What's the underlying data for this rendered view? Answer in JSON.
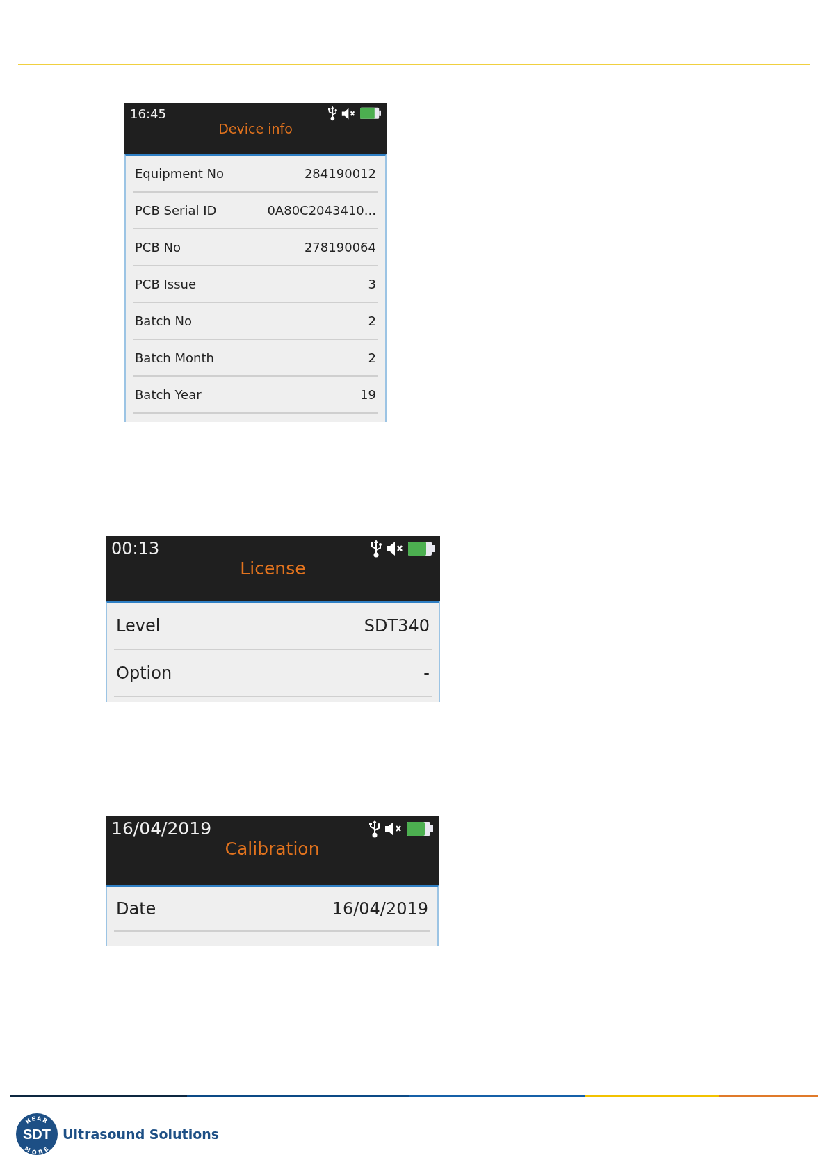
{
  "screens": [
    {
      "time": "16:45",
      "title": "Device info",
      "rows": [
        {
          "label": "Equipment No",
          "value": "284190012"
        },
        {
          "label": "PCB Serial ID",
          "value": "0A80C2043410..."
        },
        {
          "label": "PCB No",
          "value": "278190064"
        },
        {
          "label": "PCB Issue",
          "value": "3"
        },
        {
          "label": "Batch No",
          "value": "2"
        },
        {
          "label": "Batch Month",
          "value": "2"
        },
        {
          "label": "Batch Year",
          "value": "19"
        }
      ]
    },
    {
      "time": "00:13",
      "title": "License",
      "rows": [
        {
          "label": "Level",
          "value": "SDT340"
        },
        {
          "label": "Option",
          "value": "-"
        }
      ]
    },
    {
      "time": "16/04/2019",
      "title": "Calibration",
      "rows": [
        {
          "label": "Date",
          "value": "16/04/2019"
        }
      ]
    }
  ],
  "footer": {
    "logo_top": "HEAR",
    "logo_mark": "SDT",
    "logo_bottom": "MORE",
    "brand": "Ultrasound Solutions"
  }
}
